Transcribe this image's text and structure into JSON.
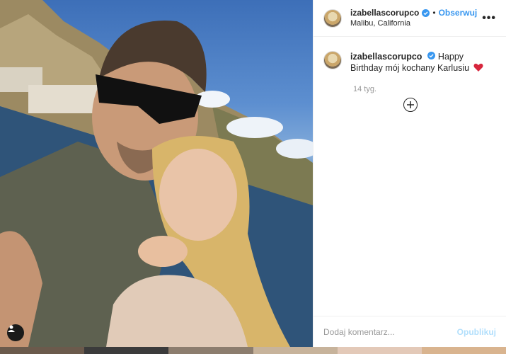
{
  "post": {
    "username": "izabellascorupco",
    "follow_label": "Obserwuj",
    "dot": "•",
    "location": "Malibu, California",
    "more_label": "•••",
    "caption": {
      "username": "izabellascorupco",
      "text": "Happy Birthday mój kochany Karlusiu"
    },
    "time_ago": "14 tyg.",
    "comment_placeholder": "Dodaj komentarz...",
    "publish_label": "Opublikuj"
  },
  "icons": {
    "verified": "verified-badge-icon",
    "heart": "red-heart-emoji",
    "load_more": "plus-circle-icon",
    "user_tag": "user-tag-icon"
  },
  "colors": {
    "link_blue": "#3897f0",
    "publish_disabled": "#b2dffc",
    "muted": "#999999"
  }
}
